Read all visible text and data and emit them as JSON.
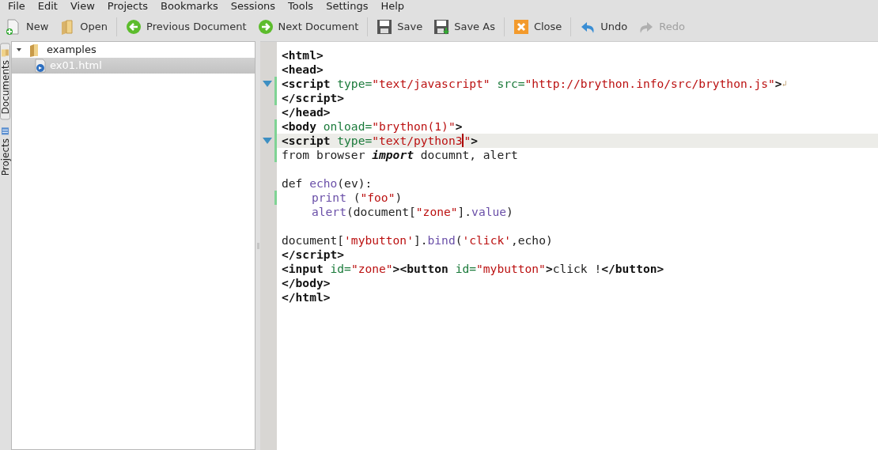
{
  "menu": [
    "File",
    "Edit",
    "View",
    "Projects",
    "Bookmarks",
    "Sessions",
    "Tools",
    "Settings",
    "Help"
  ],
  "toolbar": [
    {
      "kind": "new",
      "label": "New",
      "disabled": false
    },
    {
      "kind": "open",
      "label": "Open",
      "disabled": false
    },
    {
      "kind": "separator"
    },
    {
      "kind": "previous",
      "label": "Previous Document",
      "disabled": false
    },
    {
      "kind": "next",
      "label": "Next Document",
      "disabled": false
    },
    {
      "kind": "separator"
    },
    {
      "kind": "save",
      "label": "Save",
      "disabled": false
    },
    {
      "kind": "saveas",
      "label": "Save As",
      "disabled": false
    },
    {
      "kind": "separator"
    },
    {
      "kind": "close",
      "label": "Close",
      "disabled": false
    },
    {
      "kind": "separator"
    },
    {
      "kind": "undo",
      "label": "Undo",
      "disabled": false
    },
    {
      "kind": "redo",
      "label": "Redo",
      "disabled": true
    }
  ],
  "side_tabs": [
    {
      "label": "Documents",
      "selected": true
    },
    {
      "label": "Projects",
      "selected": false
    }
  ],
  "tree": [
    {
      "label": "examples",
      "expanded": true,
      "selected": false,
      "children": [
        {
          "label": "ex01.html",
          "selected": true
        }
      ]
    }
  ],
  "editor": {
    "lines": [
      {
        "tokens": [
          {
            "kind": "tag",
            "text": "<html>"
          }
        ],
        "fold": false,
        "modified": false,
        "current": false
      },
      {
        "tokens": [
          {
            "kind": "tag",
            "text": "<head>"
          }
        ],
        "fold": false,
        "modified": false,
        "current": false
      },
      {
        "tokens": [
          {
            "kind": "tag",
            "text": "<script "
          },
          {
            "kind": "attr",
            "text": "type="
          },
          {
            "kind": "str",
            "text": "\"text/javascript\" "
          },
          {
            "kind": "attr",
            "text": "src="
          },
          {
            "kind": "str",
            "text": "\"http://brython.info/src/brython.js\""
          },
          {
            "kind": "tag",
            "text": ">"
          },
          {
            "kind": "wrap",
            "text": "↲"
          }
        ],
        "fold": true,
        "modified": true,
        "current": false
      },
      {
        "tokens": [
          {
            "kind": "tag",
            "text": "</script>"
          }
        ],
        "fold": false,
        "modified": true,
        "current": false
      },
      {
        "tokens": [
          {
            "kind": "tag",
            "text": "</head>"
          }
        ],
        "fold": false,
        "modified": false,
        "current": false
      },
      {
        "tokens": [
          {
            "kind": "tag",
            "text": "<body "
          },
          {
            "kind": "attr",
            "text": "onload="
          },
          {
            "kind": "str",
            "text": "\"brython(1)\""
          },
          {
            "kind": "tag",
            "text": ">"
          }
        ],
        "fold": false,
        "modified": true,
        "current": false
      },
      {
        "tokens": [
          {
            "kind": "tag",
            "text": "<script "
          },
          {
            "kind": "attr",
            "text": "type="
          },
          {
            "kind": "str",
            "text": "\"text/python3",
            "caret": true
          },
          {
            "kind": "str",
            "text": "\""
          },
          {
            "kind": "tag",
            "text": ">"
          }
        ],
        "fold": true,
        "modified": true,
        "current": true
      },
      {
        "tokens": [
          {
            "kind": "plain",
            "text": "from browser "
          },
          {
            "kind": "kw",
            "text": "import"
          },
          {
            "kind": "plain",
            "text": " documnt, alert"
          }
        ],
        "fold": false,
        "modified": true,
        "current": false
      },
      {
        "kind": "blank"
      },
      {
        "tokens": [
          {
            "kind": "plain",
            "text": "def "
          },
          {
            "kind": "fn",
            "text": "echo"
          },
          {
            "kind": "plain",
            "text": "(ev):"
          }
        ],
        "fold": false,
        "modified": false,
        "current": false
      },
      {
        "indented": true,
        "tokens": [
          {
            "kind": "fn",
            "text": "print"
          },
          {
            "kind": "plain",
            "text": " ("
          },
          {
            "kind": "str",
            "text": "\"foo\""
          },
          {
            "kind": "plain",
            "text": ")"
          }
        ],
        "fold": false,
        "modified": true,
        "current": false
      },
      {
        "indented": true,
        "tokens": [
          {
            "kind": "fn",
            "text": "alert"
          },
          {
            "kind": "plain",
            "text": "(document["
          },
          {
            "kind": "str",
            "text": "\"zone\""
          },
          {
            "kind": "plain",
            "text": "]."
          },
          {
            "kind": "fn",
            "text": "value"
          },
          {
            "kind": "plain",
            "text": ")"
          }
        ],
        "fold": false,
        "modified": false,
        "current": false
      },
      {
        "kind": "blank"
      },
      {
        "tokens": [
          {
            "kind": "plain",
            "text": "document["
          },
          {
            "kind": "str",
            "text": "'mybutton'"
          },
          {
            "kind": "plain",
            "text": "]."
          },
          {
            "kind": "fn",
            "text": "bind"
          },
          {
            "kind": "plain",
            "text": "("
          },
          {
            "kind": "str",
            "text": "'click'"
          },
          {
            "kind": "plain",
            "text": ",echo)"
          }
        ],
        "fold": false,
        "modified": false,
        "current": false
      },
      {
        "tokens": [
          {
            "kind": "tag",
            "text": "</script>"
          }
        ],
        "fold": false,
        "modified": false,
        "current": false
      },
      {
        "tokens": [
          {
            "kind": "tag",
            "text": "<input "
          },
          {
            "kind": "attr",
            "text": "id="
          },
          {
            "kind": "str",
            "text": "\"zone\""
          },
          {
            "kind": "tag",
            "text": "><button "
          },
          {
            "kind": "attr",
            "text": "id="
          },
          {
            "kind": "str",
            "text": "\"mybutton\""
          },
          {
            "kind": "tag",
            "text": ">"
          },
          {
            "kind": "plain",
            "text": "click !"
          },
          {
            "kind": "tag",
            "text": "</button>"
          }
        ],
        "fold": false,
        "modified": false,
        "current": false
      },
      {
        "tokens": [
          {
            "kind": "tag",
            "text": "</body>"
          }
        ],
        "fold": false,
        "modified": false,
        "current": false
      },
      {
        "tokens": [
          {
            "kind": "tag",
            "text": "</html>"
          }
        ],
        "fold": false,
        "modified": false,
        "current": false
      }
    ]
  }
}
